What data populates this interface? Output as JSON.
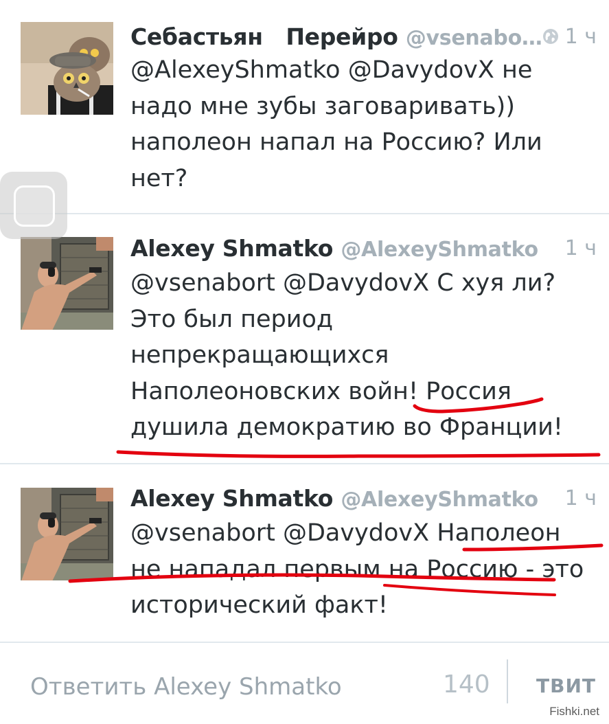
{
  "tweets": [
    {
      "name": "Себастьян   Перейро",
      "handle": "@vsenabo…",
      "time": "1 ч",
      "text": "@AlexeyShmatko @DavydovX не надо мне зубы заговаривать)) наполеон напал на Россию? Или нет?",
      "icon": "globe-icon"
    },
    {
      "name": "Alexey Shmatko",
      "handle": "@AlexeyShmatko",
      "time": "1 ч",
      "text": "@vsenabort @DavydovX  С хуя ли? Это был период непрекращающихся Наполеоновских войн! Россия душила демократию во Франции!"
    },
    {
      "name": "Alexey Shmatko",
      "handle": "@AlexeyShmatko",
      "time": "1 ч",
      "text": "@vsenabort @DavydovX Наполеон не нападал первым на Россию - это исторический факт!"
    }
  ],
  "reply": {
    "placeholder": "Ответить Alexey Shmatko",
    "counter": "140",
    "button": "ТВИТ"
  },
  "watermark": "Fishki.net",
  "colors": {
    "text": "#292f33",
    "muted": "#a5b0b8",
    "annotation": "#e3000f"
  }
}
